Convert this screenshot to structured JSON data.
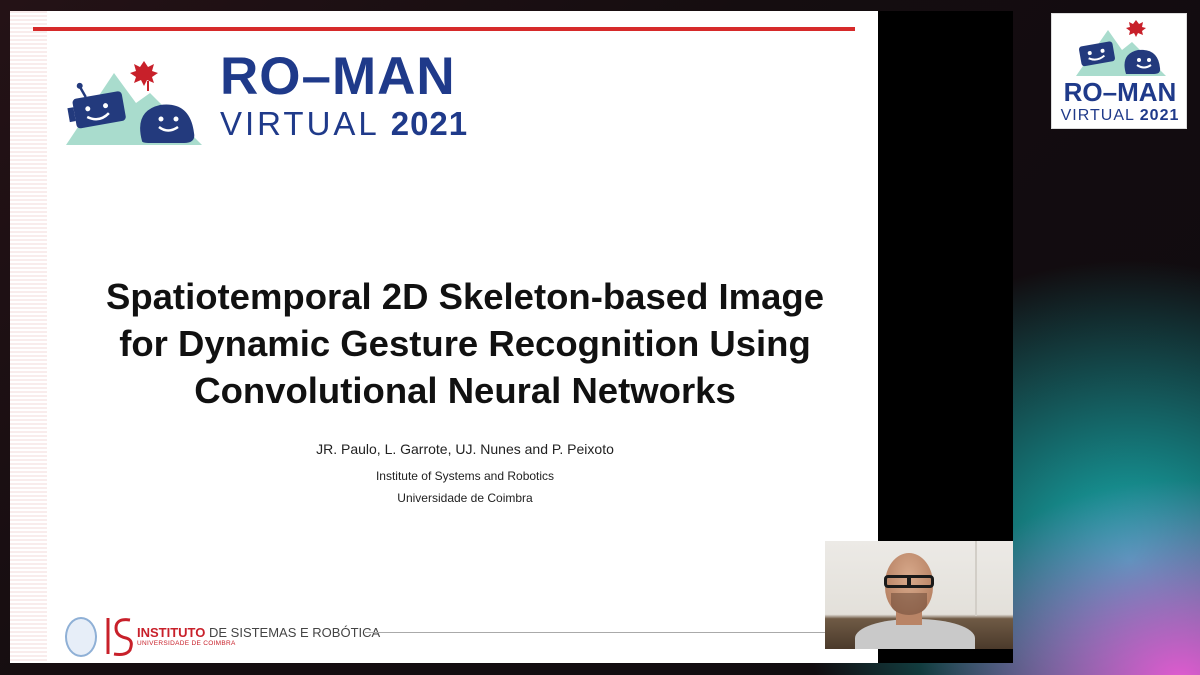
{
  "slide": {
    "brand_top": "RO–MAN",
    "brand_virtual": "VIRTUAL",
    "brand_year": "2021",
    "title_lines": [
      "Spatiotemporal 2D Skeleton-based Image",
      "for Dynamic Gesture Recognition Using",
      "Convolutional Neural Networks"
    ],
    "authors": "JR. Paulo, L. Garrote, UJ. Nunes and P. Peixoto",
    "affiliation_1": "Institute of Systems and Robotics",
    "affiliation_2": "Universidade de Coimbra",
    "footer": {
      "isr_name_highlight": "INSTITUTO",
      "isr_name_rest": " DE SISTEMAS E ROBÓTICA",
      "isr_sub": "UNIVERSIDADE DE COIMBRA"
    }
  },
  "corner_badge": {
    "title": "RO–MAN",
    "virtual": "VIRTUAL",
    "year": "2021"
  },
  "colors": {
    "brand_blue": "#1f3a8a",
    "accent_red": "#d62a2a",
    "mint": "#9fd6c6"
  }
}
